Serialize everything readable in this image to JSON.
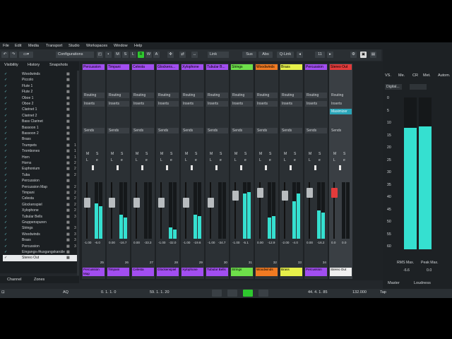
{
  "menu": [
    "File",
    "Edit",
    "Media",
    "Transport",
    "Studio",
    "Workspaces",
    "Window",
    "Help"
  ],
  "toolbar": {
    "configurations": "Configurations",
    "btn_m": "M",
    "btn_s": "S",
    "btn_l": "L",
    "btn_r": "R",
    "btn_w": "W",
    "btn_a": "A",
    "link": "Link",
    "sus": "Sus",
    "abs": "Abs",
    "qlink": "Q-Link",
    "num": "11"
  },
  "left_panel": {
    "tabs": [
      "Visibility",
      "History",
      "Snapshots"
    ],
    "rows": [
      {
        "label": "Woodwinds",
        "n": ""
      },
      {
        "label": "Piccolo",
        "n": ""
      },
      {
        "label": "Flute 1",
        "n": ""
      },
      {
        "label": "Flute 2",
        "n": ""
      },
      {
        "label": "Oboe 1",
        "n": ""
      },
      {
        "label": "Oboe 2",
        "n": ""
      },
      {
        "label": "Clarinet 1",
        "n": ""
      },
      {
        "label": "Clarinet 2",
        "n": ""
      },
      {
        "label": "Bass Clarinet",
        "n": ""
      },
      {
        "label": "Bassoon 1",
        "n": ""
      },
      {
        "label": "Bassoon 2",
        "n": ""
      },
      {
        "label": "Brass",
        "n": ""
      },
      {
        "label": "Trumpets",
        "n": "1"
      },
      {
        "label": "Trombones",
        "n": "1"
      },
      {
        "label": "Horn",
        "n": "1"
      },
      {
        "label": "Horns",
        "n": "2"
      },
      {
        "label": "Euphonium",
        "n": "2"
      },
      {
        "label": "Tuba",
        "n": "2"
      },
      {
        "label": "Percussion",
        "n": ""
      },
      {
        "label": "Percussion Map",
        "n": "2"
      },
      {
        "label": "Timpani",
        "n": "2"
      },
      {
        "label": "Celesta",
        "n": "2"
      },
      {
        "label": "Glockenspiel",
        "n": "2"
      },
      {
        "label": "Xylophone",
        "n": "2"
      },
      {
        "label": "Tubular Bells",
        "n": "3"
      },
      {
        "label": "Gruppenspuren",
        "n": ""
      },
      {
        "label": "Strings",
        "n": "3"
      },
      {
        "label": "Woodwinds",
        "n": "3"
      },
      {
        "label": "Brass",
        "n": "3"
      },
      {
        "label": "Percussion",
        "n": "3"
      },
      {
        "label": "Eingangs-/Ausgangskanäle",
        "n": ""
      },
      {
        "label": "Stereo Out",
        "n": ""
      }
    ],
    "footer": [
      "Channel",
      "Zones"
    ]
  },
  "strips": [
    {
      "name": "Percussion Map",
      "top": "Percussion",
      "color": "#a24ef0",
      "l": "-1.00",
      "r": "-6.0",
      "num": "25",
      "m1": 62,
      "m2": 58,
      "cap": 22
    },
    {
      "name": "Timpani",
      "top": "Timpani",
      "color": "#a24ef0",
      "l": "0.00",
      "r": "-16.7",
      "num": "26",
      "m1": 42,
      "m2": 38,
      "cap": 22
    },
    {
      "name": "Celesta",
      "top": "Celesta",
      "color": "#a24ef0",
      "l": "0.00",
      "r": "-33.3",
      "num": "27",
      "m1": 0,
      "m2": 0,
      "cap": 22
    },
    {
      "name": "Glockenspiel",
      "top": "Glockens...",
      "color": "#a24ef0",
      "l": "-1.00",
      "r": "-32.0",
      "num": "28",
      "m1": 20,
      "m2": 16,
      "cap": 22
    },
    {
      "name": "Xylophone",
      "top": "Xylophone",
      "color": "#a24ef0",
      "l": "-1.00",
      "r": "-19.6",
      "num": "29",
      "m1": 42,
      "m2": 40,
      "cap": 22
    },
    {
      "name": "Tubular Bells",
      "top": "Tubular B...",
      "color": "#a24ef0",
      "l": "-1.00",
      "r": "-34.7",
      "num": "30",
      "m1": 0,
      "m2": 0,
      "cap": 22
    },
    {
      "name": "Strings",
      "top": "Strings",
      "color": "#6ee04a",
      "l": "-1.00",
      "r": "-5.1",
      "num": "31",
      "m1": 80,
      "m2": 82,
      "cap": 12
    },
    {
      "name": "Woodwinds",
      "top": "Woodwinds",
      "color": "#f07a22",
      "l": "0.00",
      "r": "-12.9",
      "num": "32",
      "m1": 38,
      "m2": 40,
      "cap": 8
    },
    {
      "name": "Brass",
      "top": "Brass",
      "color": "#e6f04a",
      "l": "-2.00",
      "r": "-4.0",
      "num": "33",
      "m1": 66,
      "m2": 80,
      "cap": 12
    },
    {
      "name": "Percussion",
      "top": "Percussion",
      "color": "#a24ef0",
      "l": "0.00",
      "r": "-16.2",
      "num": "34",
      "m1": 50,
      "m2": 46,
      "cap": 8
    },
    {
      "name": "Stereo Out",
      "top": "Stereo Out",
      "color": "#e33b3b",
      "l": "0.0",
      "r": "0.0",
      "num": "",
      "m1": 0,
      "m2": 0,
      "cap": 8
    }
  ],
  "strip_labels": {
    "routing": "Routing",
    "inserts": "Inserts",
    "sends": "Sends",
    "m": "M",
    "s": "S",
    "l": "L",
    "e": "e",
    "insert_slot": "Maximizer"
  },
  "right_panel": {
    "cols": [
      "VS.",
      "Me.",
      "CR",
      "Met.",
      "Autom."
    ],
    "digital": "Digital...",
    "scale": [
      "0",
      "5",
      "10",
      "15",
      "20",
      "25",
      "30",
      "35",
      "40",
      "45",
      "50",
      "55",
      "60"
    ],
    "rms_label": "RMS Max.",
    "peak_label": "Peak Max.",
    "rms": "-6.6",
    "peak": "0.0",
    "tabs": [
      "Master",
      "Loudness"
    ],
    "meter_l": 80,
    "meter_r": 81
  },
  "transport": {
    "left_pos": "0. 1. 1. 0",
    "mid_pos": "59. 1. 1. 20",
    "right_pos": "44. 4. 1. 85",
    "tempo": "132.000",
    "tap": "Tap",
    "aq": "AQ"
  },
  "colors": {
    "accent": "#35e0d0",
    "record": "#e33b3b",
    "play": "#2ec82e",
    "active_r": "#2ec82e"
  }
}
